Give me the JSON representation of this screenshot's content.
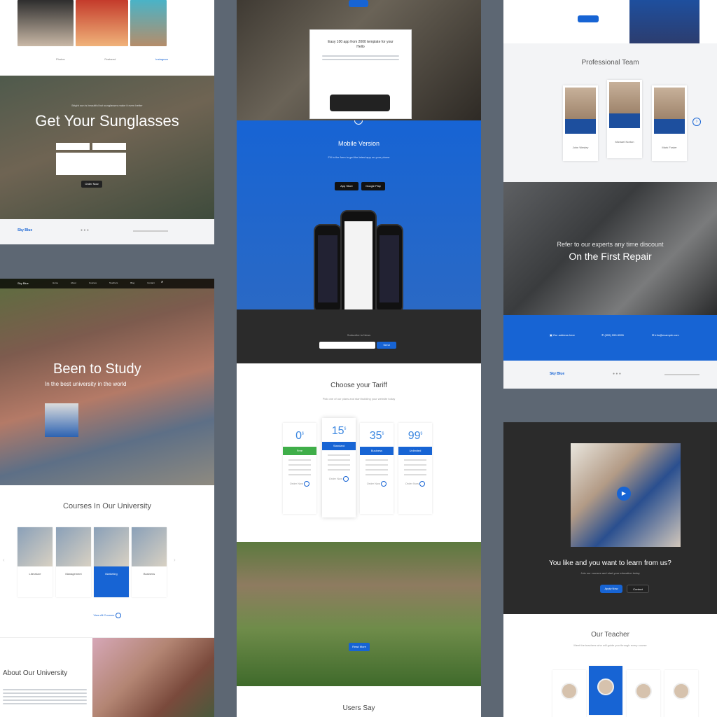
{
  "col1": {
    "top_tabs": [
      "Photos",
      "Featured",
      "Instagram"
    ],
    "sunglasses_title": "Get Your Sunglasses",
    "sunglasses_sub": "Bright sun is beautiful but sunglasses make it even better",
    "sunglasses_button": "Order Now",
    "footer_logo": "Sky Blue",
    "nav_items": [
      "Home",
      "About",
      "Courses",
      "Teachers",
      "Blog",
      "Contact"
    ],
    "study_title": "Been to Study",
    "study_sub": "In the best university in the world",
    "courses_title": "Courses In Our University",
    "courses": [
      "Literature",
      "Management",
      "Marketing",
      "Business"
    ],
    "courses_link": "View All Courses",
    "about_title": "About Our University"
  },
  "col2": {
    "app_title": "Easy 100 app from 2000 template for your Hello",
    "mobile_title": "Mobile Version",
    "mobile_desc": "Fill in the form to get the latest app on your phone",
    "store_buttons": [
      "App Store",
      "Google Play"
    ],
    "subscribe_label": "Subscribe to News",
    "subscribe_button": "Send",
    "tariff_title": "Choose your Tariff",
    "tariff_sub": "Pick one of our plans and start building your website today",
    "tariffs": [
      {
        "price": "0",
        "unit": "$",
        "name": "Free",
        "color": "#3fae49"
      },
      {
        "price": "15",
        "unit": "$",
        "name": "Standard",
        "color": "#1764d4"
      },
      {
        "price": "35",
        "unit": "$",
        "name": "Business",
        "color": "#1764d4"
      },
      {
        "price": "99",
        "unit": "$",
        "name": "Unlimited",
        "color": "#1764d4"
      }
    ],
    "tariff_link": "Order Now",
    "park_button": "Read More",
    "users_say": "Users Say"
  },
  "col3": {
    "team_title": "Professional Team",
    "team": [
      "John Wesley",
      "Michael Norton",
      "Mark Foster"
    ],
    "repair_line1": "Refer to our experts any time discount",
    "repair_line2": "On the First Repair",
    "contact_items": [
      "Our address here",
      "(555) 555-5555",
      "info@example.com"
    ],
    "footer_logo": "Sky Blue",
    "learn_title": "You like and you want to learn from us?",
    "learn_sub": "Join our courses and start your education today",
    "learn_buttons": [
      "Apply Now",
      "Contact"
    ],
    "teacher_title": "Our Teacher",
    "teacher_sub": "Meet the teachers who will guide you through every course"
  },
  "colors": {
    "background": "#5d6773",
    "accent": "#1764d4",
    "dark": "#2b2b2b",
    "green": "#3fae49"
  }
}
